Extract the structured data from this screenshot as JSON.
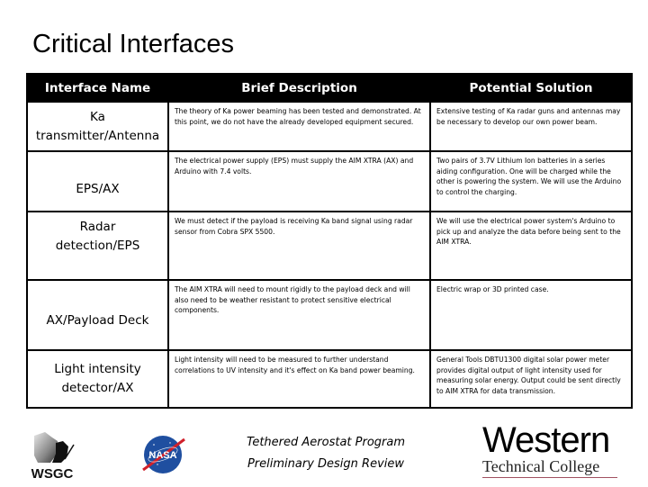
{
  "title": "Critical Interfaces",
  "table": {
    "headers": [
      "Interface Name",
      "Brief Description",
      "Potential Solution"
    ],
    "rows": [
      {
        "name": "Ka transmitter/Antenna",
        "description": "The theory of Ka power beaming has been tested and demonstrated.  At this point, we do not have the already developed equipment secured.",
        "solution": "Extensive testing of Ka radar guns and antennas may be necessary to develop our own power beam."
      },
      {
        "name": "EPS/AX",
        "description": "The electrical power supply (EPS) must supply the AIM XTRA (AX) and Arduino with 7.4 volts.",
        "solution": "Two pairs of 3.7V Lithium Ion batteries in a series aiding configuration.  One will be charged while the other is powering the system.  We will use the Arduino to control the charging."
      },
      {
        "name": "Radar detection/EPS",
        "description": "We must detect if the payload is receiving Ka band signal using radar sensor from Cobra SPX 5500.",
        "solution": "We will use the electrical power system's Arduino to pick up and analyze the data before being sent to the AIM XTRA."
      },
      {
        "name": "AX/Payload Deck",
        "description": "The AIM XTRA will need to mount rigidly to the payload deck and will also need to be weather resistant to protect sensitive electrical components.",
        "solution": "Electric wrap or 3D printed case."
      },
      {
        "name": "Light intensity detector/AX",
        "description": "Light intensity will need to be measured to further understand correlations to UV intensity and it's effect on Ka band power beaming.",
        "solution": "General Tools DBTU1300 digital solar power meter provides digital output of light intensity used for measuring solar energy.  Output could be sent directly to AIM XTRA for data transmission."
      }
    ]
  },
  "footer": {
    "line1": "Tethered Aerostat Program",
    "line2": "Preliminary Design Review",
    "logos": {
      "wsgc": "WSGC",
      "nasa": "NASA",
      "western_top": "Western",
      "western_bottom": "Technical College"
    }
  },
  "colors": {
    "header_bg": "#000000",
    "header_text": "#ffffff",
    "nasa_blue": "#1f4fa0",
    "nasa_red": "#d0202a",
    "wtc_rule": "#a05060"
  }
}
